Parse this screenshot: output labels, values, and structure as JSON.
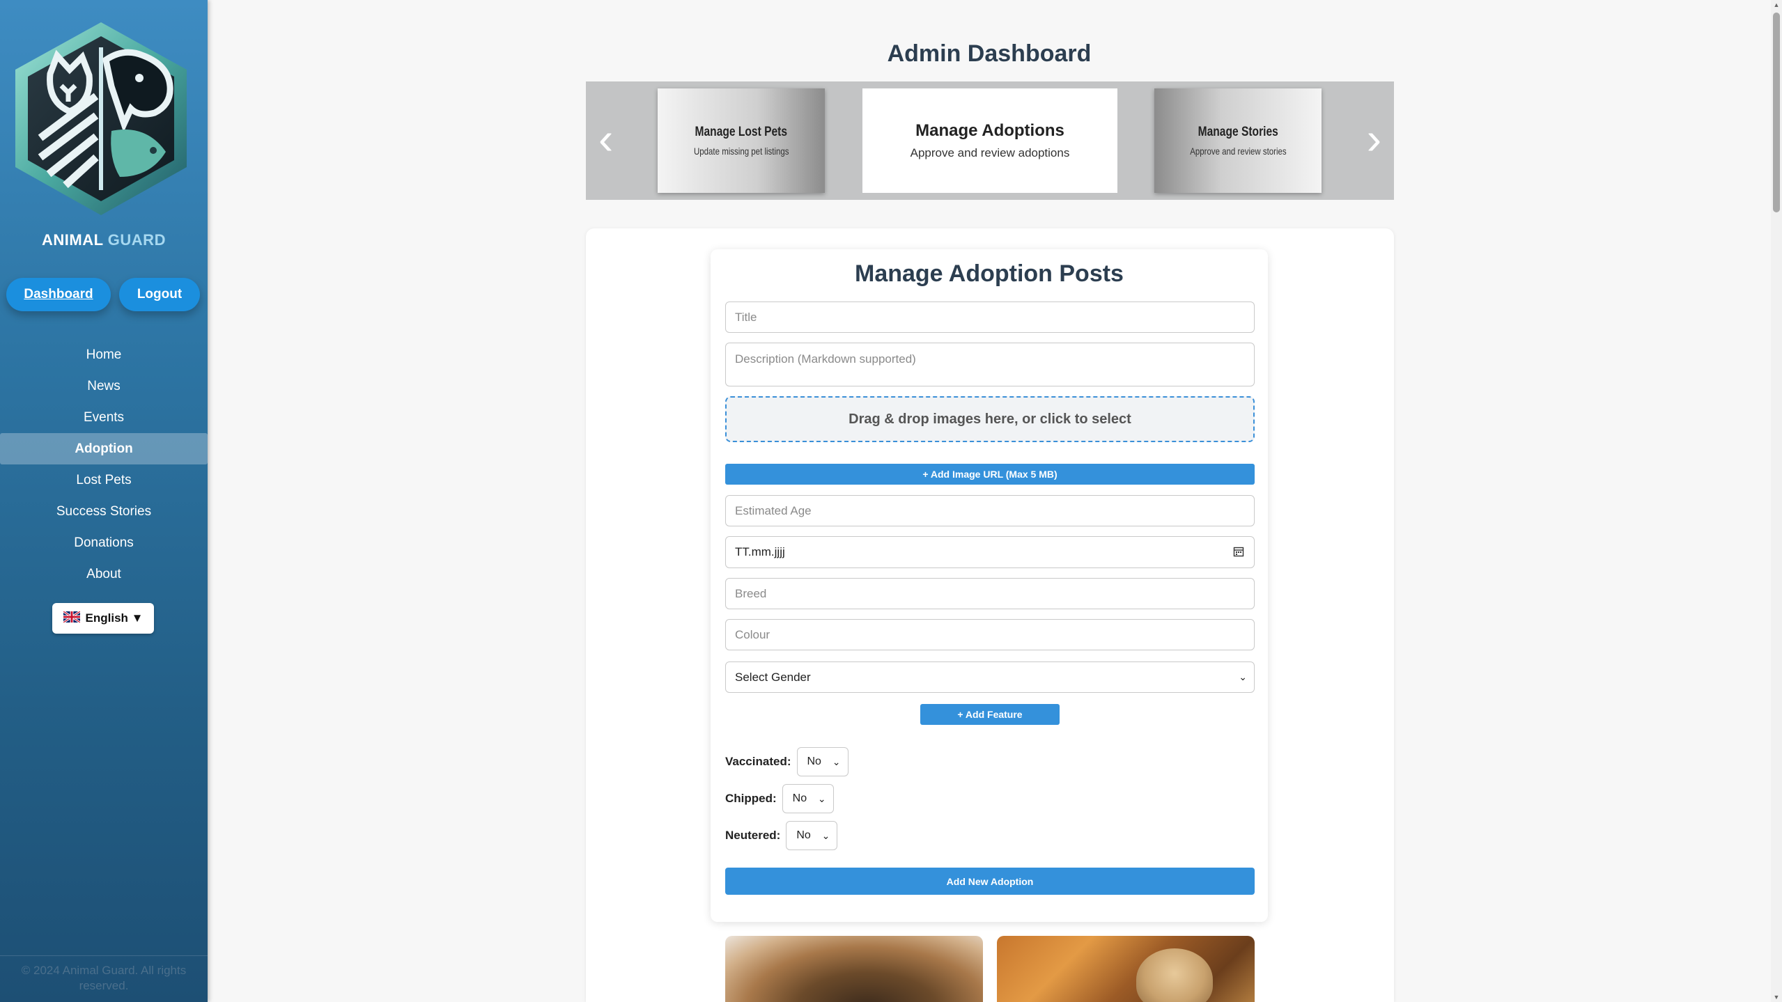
{
  "sidebar": {
    "brand_part1": "ANIMAL",
    "brand_part2": "GUARD",
    "dashboard_label": "Dashboard",
    "logout_label": "Logout",
    "nav": [
      "Home",
      "News",
      "Events",
      "Adoption",
      "Lost Pets",
      "Success Stories",
      "Donations",
      "About"
    ],
    "active_nav": "Adoption",
    "language_label": "English ▼",
    "language_flag": "🇬🇧",
    "copyright": "© 2024 Animal Guard. All rights reserved."
  },
  "main": {
    "title": "Admin Dashboard",
    "carousel": {
      "prev": "‹",
      "next": "›",
      "cards": [
        {
          "title": "Manage Lost Pets",
          "subtitle": "Update missing pet listings"
        },
        {
          "title": "Manage Adoptions",
          "subtitle": "Approve and review adoptions"
        },
        {
          "title": "Manage Stories",
          "subtitle": "Approve and review stories"
        }
      ]
    },
    "form": {
      "title": "Manage Adoption Posts",
      "title_placeholder": "Title",
      "description_placeholder": "Description (Markdown supported)",
      "dropzone_text": "Drag & drop images here, or click to select",
      "add_image_url": "+ Add Image URL (Max 5 MB)",
      "age_placeholder": "Estimated Age",
      "date_value": "TT.mm.jjjj",
      "breed_placeholder": "Breed",
      "colour_placeholder": "Colour",
      "gender_select": "Select Gender",
      "add_feature": "+ Add Feature",
      "vaccinated_label": "Vaccinated:",
      "vaccinated_value": "No",
      "chipped_label": "Chipped:",
      "chipped_value": "No",
      "neutered_label": "Neutered:",
      "neutered_value": "No",
      "submit": "Add New Adoption"
    }
  },
  "colors": {
    "accent": "#3491db",
    "sidebar_top": "#3e8cc2",
    "sidebar_bottom": "#1d4f74",
    "heading": "#2c3e50"
  },
  "icons": {
    "calendar": "calendar-icon",
    "chevron": "chevron-down-icon",
    "arrow_left": "arrow-left-icon",
    "arrow_right": "arrow-right-icon"
  }
}
